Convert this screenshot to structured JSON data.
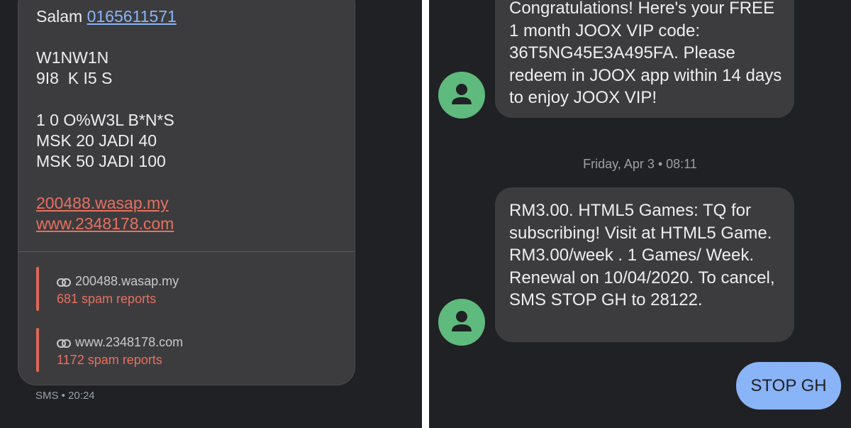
{
  "spam_message": {
    "greeting": "Salam",
    "sender_phone": "0165611571",
    "lines": [
      "W1NW1N",
      "9I8  K I5 S",
      "1 0 O%W3L B*N*S",
      "MSK 20 JADI 40",
      "MSK 50 JADI 100"
    ],
    "links": [
      "200488.wasap.my",
      "www.2348178.com"
    ],
    "reports": [
      {
        "url": "200488.wasap.my",
        "count": "681 spam reports"
      },
      {
        "url": "www.2348178.com",
        "count": "1172 spam reports"
      }
    ],
    "meta": "SMS • 20:24"
  },
  "conversation": {
    "messages": [
      {
        "text": "Congratulations! Here's your FREE 1 month JOOX VIP code: 36T5NG45E3A495FA. Please redeem in JOOX app within 14 days to enjoy JOOX VIP!"
      },
      {
        "text": "RM3.00. HTML5 Games: TQ for subscribing! Visit at HTML5 Game. RM3.00/week . 1 Games/ Week. Renewal on 10/04/2020. To cancel, SMS STOP GH to 28122."
      }
    ],
    "timestamp": "Friday, Apr 3 • 08:11",
    "reply": "STOP GH"
  },
  "icons": {
    "avatar": "person-icon",
    "link": "link-icon"
  },
  "colors": {
    "background": "#202124",
    "bubble": "#3c3c3e",
    "link_blue": "#8ab4f8",
    "spam_red": "#e8705f",
    "avatar_green": "#5fba7d",
    "reply_bubble": "#8ab4f8"
  }
}
